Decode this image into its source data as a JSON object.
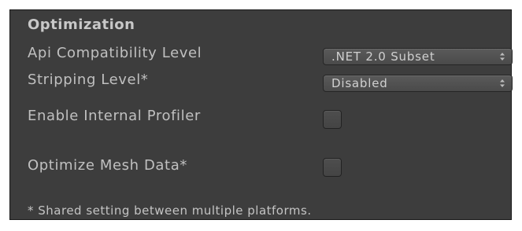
{
  "section": {
    "title": "Optimization"
  },
  "rows": {
    "api_compat": {
      "label": "Api Compatibility Level",
      "value": ".NET 2.0 Subset"
    },
    "stripping": {
      "label": "Stripping Level*",
      "value": "Disabled"
    },
    "profiler": {
      "label": "Enable Internal Profiler",
      "checked": false
    },
    "mesh": {
      "label": "Optimize Mesh Data*",
      "checked": false
    }
  },
  "footnote": "* Shared setting between multiple platforms.",
  "icons": {
    "dropdown": "chevron-up-down-icon"
  },
  "colors": {
    "panel_bg": "#3d3d3d",
    "text": "#c4c4c4",
    "control_bg": "#505050"
  }
}
